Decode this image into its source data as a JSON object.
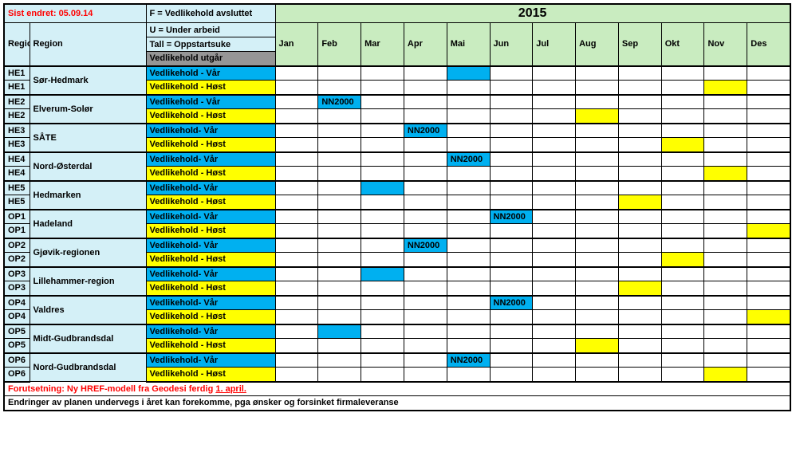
{
  "header": {
    "lastChanged": "Sist endret: 05.09.14",
    "fLabel": "F",
    "fDesc": " = Vedlikehold avsluttet",
    "uLine": "U = Under arbeid",
    "tallLine": "Tall = Oppstartsuke",
    "utgar": "Vedlikehold utgår",
    "year": "2015",
    "regionCodeHdr": "Regionnr",
    "regionHdr": "Region"
  },
  "months": [
    "Jan",
    "Feb",
    "Mar",
    "Apr",
    "Mai",
    "Jun",
    "Jul",
    "Aug",
    "Sep",
    "Okt",
    "Nov",
    "Des"
  ],
  "statusLabels": {
    "var": "Vedlikehold - Vår",
    "var2": "Vedlikehold- Vår",
    "host": "Vedlikehold - Høst"
  },
  "nn": "NN2000",
  "regions": [
    {
      "code": "HE1",
      "name": "Sør-Hedmark",
      "varLabel": "var",
      "varNN": 4,
      "hostFill": 10
    },
    {
      "code": "HE2",
      "name": "Elverum-Solør",
      "varLabel": "var",
      "varNN": 1,
      "varNNText": true,
      "hostFill": 7
    },
    {
      "code": "HE3",
      "name": "SÅTE",
      "varLabel": "var2",
      "varNN": 3,
      "varNNText": true,
      "hostFill": 9
    },
    {
      "code": "HE4",
      "name": "Nord-Østerdal",
      "varLabel": "var2",
      "varNN": 4,
      "varNNText": true,
      "hostFill": 10
    },
    {
      "code": "HE5",
      "name": "Hedmarken",
      "varLabel": "var2",
      "varNN": 2,
      "hostFill": 8
    },
    {
      "code": "OP1",
      "name": "Hadeland",
      "varLabel": "var2",
      "varNN": 5,
      "varNNText": true,
      "hostFill": 11
    },
    {
      "code": "OP2",
      "name": "Gjøvik-regionen",
      "varLabel": "var2",
      "varNN": 3,
      "varNNText": true,
      "hostFill": 9
    },
    {
      "code": "OP3",
      "name": "Lillehammer-region",
      "varLabel": "var2",
      "varNN": 2,
      "hostFill": 8
    },
    {
      "code": "OP4",
      "name": "Valdres",
      "varLabel": "var2",
      "varNN": 5,
      "varNNText": true,
      "hostFill": 11
    },
    {
      "code": "OP5",
      "name": "Midt-Gudbrandsdal",
      "varLabel": "var2",
      "varNN": 1,
      "hostFill": 7
    },
    {
      "code": "OP6",
      "name": "Nord-Gudbrandsdal",
      "varLabel": "var2",
      "varNN": 4,
      "varNNText": true,
      "hostFill": 10
    }
  ],
  "footer": {
    "line1a": "Forutsetning: Ny HREF-modell  fra Geodesi ferdig ",
    "line1b": "1. april.",
    "line2": "Endringer av planen undervegs i året kan forekomme, pga ønsker og forsinket firmaleveranse"
  }
}
